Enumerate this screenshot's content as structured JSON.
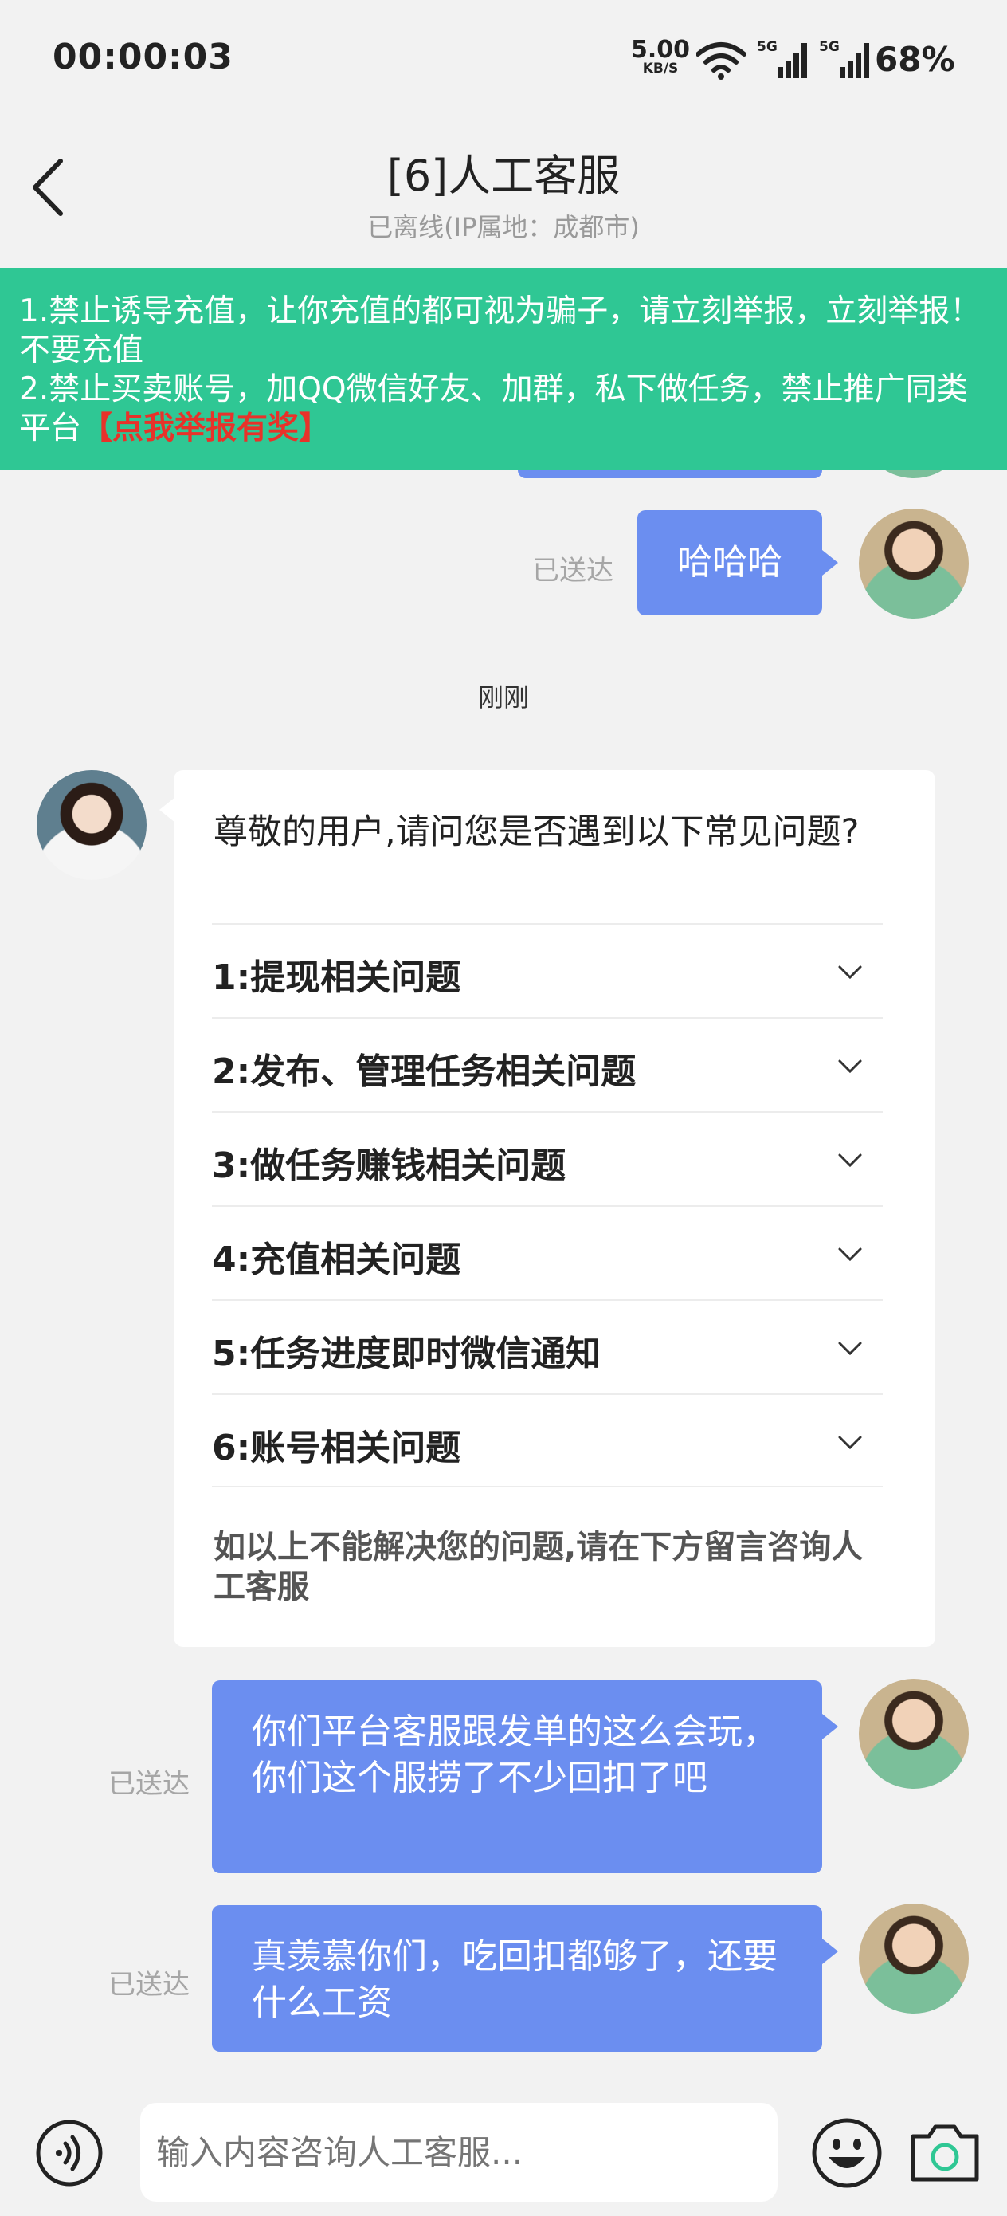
{
  "status_bar": {
    "time": "00:00:03",
    "net_speed": "5.00",
    "net_unit": "KB/S",
    "signal1": "5G",
    "signal2": "5G",
    "battery": "68%"
  },
  "header": {
    "title": "[6]人工客服",
    "subtitle": "已离线(IP属地：成都市)"
  },
  "notice": {
    "line1": "1.禁止诱导充值，让你充值的都可视为骗子，请立刻举报，立刻举报！不要充值",
    "line2": "2.禁止买卖账号，加QQ微信好友、加群，私下做任务，禁止推广同类平台",
    "report_link": "【点我举报有奖】"
  },
  "messages": {
    "msg1_text": "哈哈哈",
    "msg1_status": "已送达",
    "time_divider": "刚刚",
    "msg3_text": "你们平台客服跟发单的这么会玩，你们这个服捞了不少回扣了吧",
    "msg3_status": "已送达",
    "msg4_text": "真羡慕你们，吃回扣都够了，还要什么工资",
    "msg4_status": "已送达"
  },
  "faq": {
    "question": "尊敬的用户,请问您是否遇到以下常见问题?",
    "items": [
      "1:提现相关问题",
      "2:发布、管理任务相关问题",
      "3:做任务赚钱相关问题",
      "4:充值相关问题",
      "5:任务进度即时微信通知",
      "6:账号相关问题"
    ],
    "footer": "如以上不能解决您的问题,请在下方留言咨询人工客服"
  },
  "input": {
    "placeholder": "输入内容咨询人工客服..."
  },
  "colors": {
    "notice_bg": "#2fc794",
    "bubble_bg": "#6b8ef0",
    "report_red": "#e8322a"
  },
  "icons": [
    "back-arrow-icon",
    "wifi-icon",
    "signal-icon",
    "voice-icon",
    "chevron-down-icon",
    "emoji-icon",
    "camera-icon"
  ]
}
